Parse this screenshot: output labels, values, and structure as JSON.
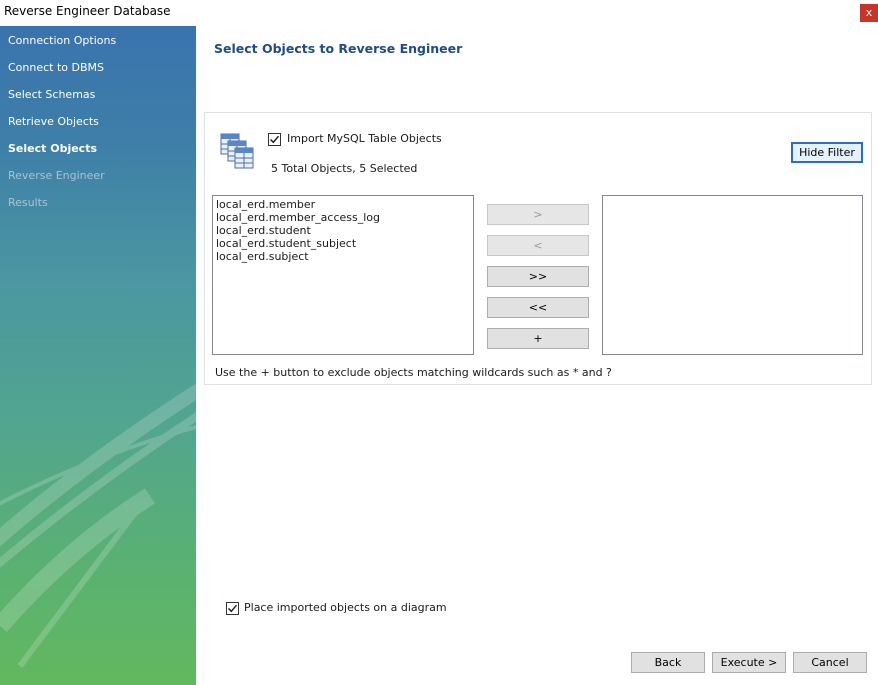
{
  "window": {
    "title": "Reverse Engineer Database",
    "close_label": "x"
  },
  "sidebar": {
    "steps": [
      {
        "label": "Connection Options",
        "state": "done"
      },
      {
        "label": "Connect to DBMS",
        "state": "done"
      },
      {
        "label": "Select Schemas",
        "state": "done"
      },
      {
        "label": "Retrieve Objects",
        "state": "done"
      },
      {
        "label": "Select Objects",
        "state": "current"
      },
      {
        "label": "Reverse Engineer",
        "state": "pending"
      },
      {
        "label": "Results",
        "state": "pending"
      }
    ]
  },
  "page": {
    "heading": "Select Objects to Reverse Engineer"
  },
  "filter": {
    "import_label": "Import MySQL Table Objects",
    "import_checked": true,
    "count_label": "5 Total Objects, 5 Selected",
    "hide_filter_label": "Hide Filter",
    "left_items": [
      "local_erd.member",
      "local_erd.member_access_log",
      "local_erd.student",
      "local_erd.student_subject",
      "local_erd.subject"
    ],
    "right_items": [],
    "move_buttons": {
      "add": ">",
      "remove": "<",
      "add_all": ">>",
      "remove_all": "<<",
      "wildcard": "+"
    },
    "hint": "Use the + button to exclude objects matching wildcards such as * and ?"
  },
  "options": {
    "place_label": "Place imported objects on a diagram",
    "place_checked": true
  },
  "footer": {
    "back": "Back",
    "execute": "Execute >",
    "cancel": "Cancel"
  },
  "colors": {
    "heading": "#1f4b8c",
    "close_button": "#c8342a",
    "sidebar_top": "#3a73ae",
    "sidebar_bottom": "#62b85e",
    "focus_border": "#2a6fc7"
  }
}
